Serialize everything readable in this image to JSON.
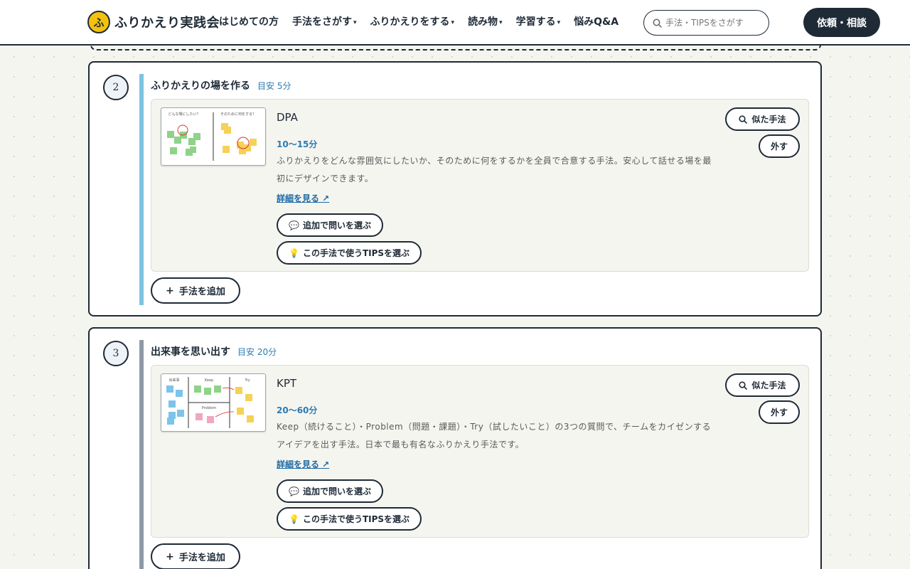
{
  "header": {
    "logo_mark": "ふ",
    "logo_text": "ふりかえり実践会",
    "nav": [
      {
        "label": "はじめての方"
      },
      {
        "label": "手法をさがす",
        "caret": "▾"
      },
      {
        "label": "ふりかえりをする",
        "caret": "▾"
      },
      {
        "label": "読み物",
        "caret": "▾"
      },
      {
        "label": "学習する",
        "caret": "▾"
      },
      {
        "label": "悩みQ&A"
      }
    ],
    "search_placeholder": "手法・TIPSをさがす",
    "cta_label": "依頼・相談"
  },
  "colors": {
    "ink": "#1e2a36",
    "step2_bar": "#7ec3e0",
    "step3_bar": "#8e99a6",
    "accent_blue": "#2b7cb3",
    "sticky_green": "#8fd28a",
    "sticky_yellow": "#f6d155",
    "sticky_blue": "#7cc4ea",
    "sticky_pink": "#f2a6c0"
  },
  "steps": [
    {
      "number": "2",
      "title": "ふりかえりの場を作る",
      "time": "目安 5分",
      "method": {
        "name": "DPA",
        "duration": "10〜15分",
        "description": "ふりかえりをどんな雰囲気にしたいか、そのために何をするかを全員で合意する手法。安心して話せる場を最初にデザインできます。",
        "link": "詳細を見る ↗",
        "thumb_labels": [
          "どんな場にしたい？",
          "そのために何をする？"
        ],
        "similar_label": "似た手法",
        "remove_label": "外す",
        "question_label": "追加で問いを選ぶ",
        "question_icon": "💬",
        "tips_label": "この手法で使うTIPSを選ぶ",
        "tips_icon": "💡"
      },
      "add_label": "手法を追加",
      "add_icon": "+"
    },
    {
      "number": "3",
      "title": "出来事を思い出す",
      "time": "目安 20分",
      "method": {
        "name": "KPT",
        "duration": "20〜60分",
        "description": "Keep（続けること）・Problem（問題・課題）・Try（試したいこと）の3つの質問で、チームをカイゼンするアイデアを出す手法。日本で最も有名なふりかえり手法です。",
        "link": "詳細を見る ↗",
        "thumb_labels": [
          "出来事",
          "Keep",
          "Try",
          "Problem"
        ],
        "similar_label": "似た手法",
        "remove_label": "外す",
        "question_label": "追加で問いを選ぶ",
        "question_icon": "💬",
        "tips_label": "この手法で使うTIPSを選ぶ",
        "tips_icon": "💡"
      },
      "add_label": "手法を追加",
      "add_icon": "+"
    }
  ]
}
